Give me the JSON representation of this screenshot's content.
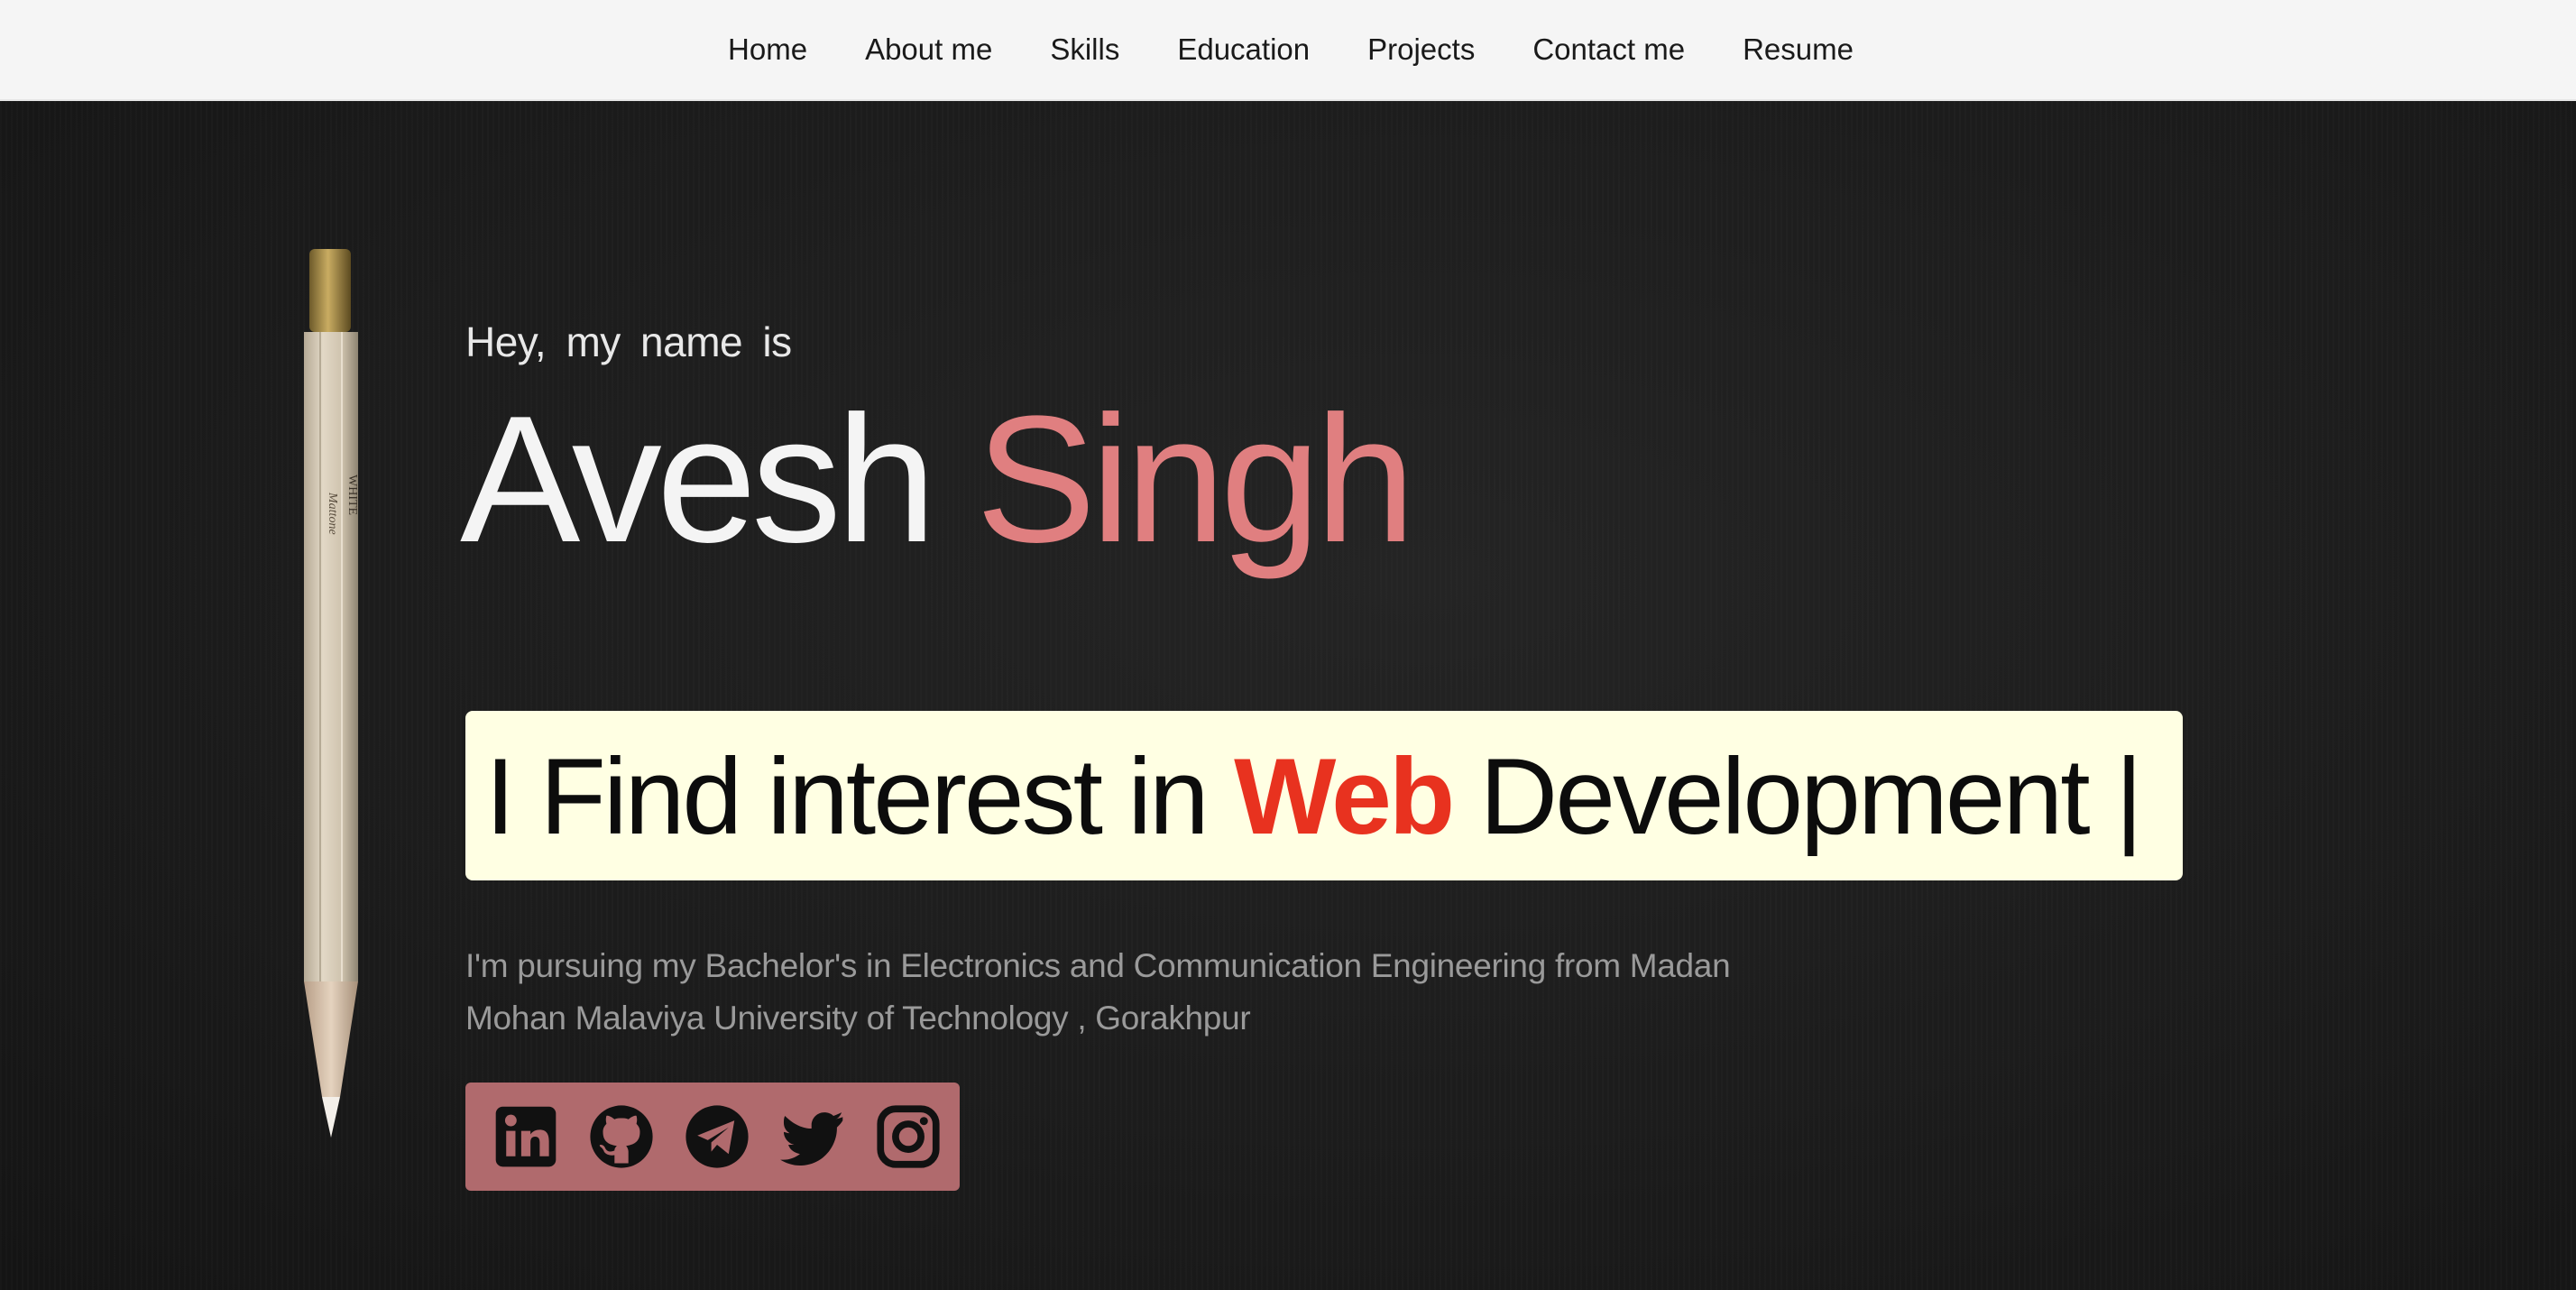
{
  "nav": {
    "items": [
      {
        "label": "Home"
      },
      {
        "label": "About me"
      },
      {
        "label": "Skills"
      },
      {
        "label": "Education"
      },
      {
        "label": "Projects"
      },
      {
        "label": "Contact me"
      },
      {
        "label": "Resume"
      }
    ]
  },
  "hero": {
    "intro": "Hey,  my name is",
    "first_name": "Avesh",
    "last_name": "Singh",
    "tagline_prefix": "I Find interest in ",
    "tagline_highlight": "Web",
    "tagline_suffix": " Development |",
    "description": "I'm pursuing my Bachelor's in Electronics and Communication Engineering from Madan Mohan Malaviya University of Technology , Gorakhpur"
  },
  "social": {
    "icons": [
      "linkedin-icon",
      "github-icon",
      "telegram-icon",
      "twitter-icon",
      "instagram-icon"
    ]
  },
  "colors": {
    "nav_bg": "#f5f5f5",
    "hero_bg": "#1d1d1d",
    "last_name": "#e07f80",
    "tagline_bg": "#ffffe3",
    "tagline_highlight": "#e8321f",
    "social_bg": "#b06a6d"
  }
}
